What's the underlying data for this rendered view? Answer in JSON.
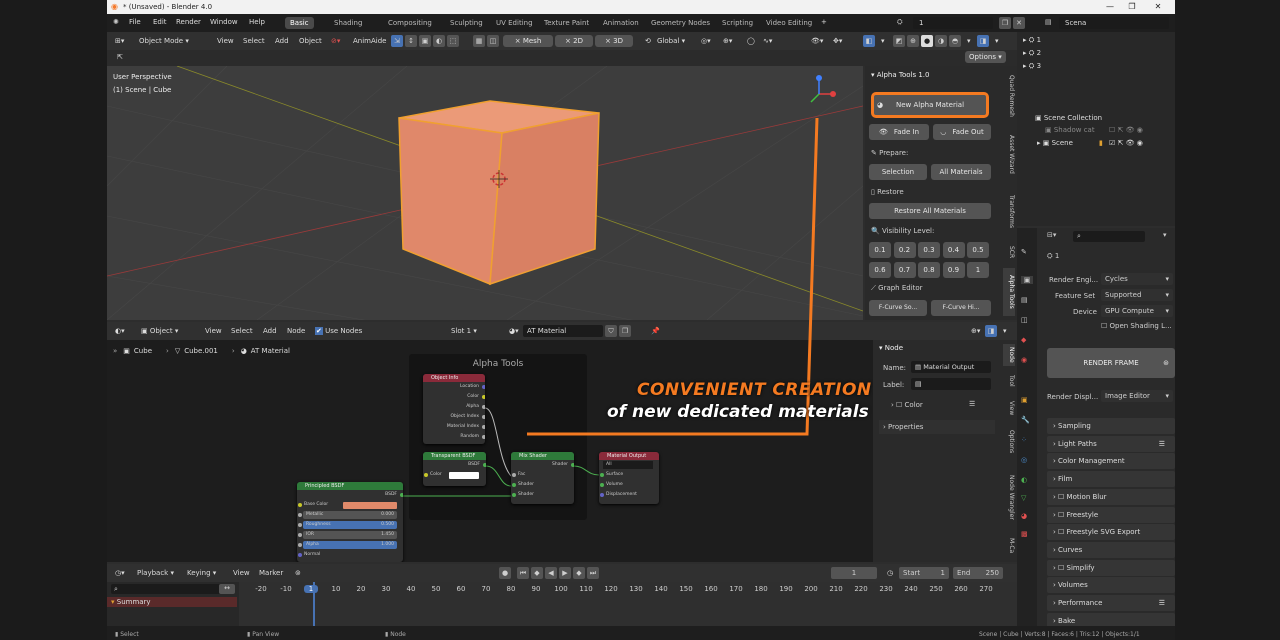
{
  "window": {
    "title": "* (Unsaved) - Blender 4.0",
    "min": "—",
    "max": "❐",
    "close": "✕"
  },
  "menu": [
    "File",
    "Edit",
    "Render",
    "Window",
    "Help"
  ],
  "workspaces": [
    "Basic",
    "Shading",
    "Compositing",
    "Sculpting",
    "UV Editing",
    "Texture Paint",
    "Animation",
    "Geometry Nodes",
    "Scripting",
    "Video Editing"
  ],
  "add_workspace": "+",
  "topright": {
    "scene_num": "1",
    "scene_name": "Scena"
  },
  "viewport_header": {
    "mode": "Object Mode",
    "view": "View",
    "select": "Select",
    "add": "Add",
    "object": "Object",
    "animaide": "AnimAide",
    "mesh": "× Mesh",
    "two_d": "× 2D",
    "three_d": "× 3D",
    "orientation": "Global",
    "options": "Options"
  },
  "viewport": {
    "perspective": "User Perspective",
    "scene_obj": "(1) Scene | Cube"
  },
  "alpha_panel": {
    "title": "Alpha Tools 1.0",
    "new_material": "New Alpha Material",
    "fade_in": "Fade In",
    "fade_out": "Fade Out",
    "prepare": "Prepare:",
    "selection": "Selection",
    "all_materials": "All Materials",
    "restore": "Restore",
    "restore_all": "Restore All Materials",
    "visibility": "Visibility Level:",
    "levels": [
      "0.1",
      "0.2",
      "0.3",
      "0.4",
      "0.5",
      "0.6",
      "0.7",
      "0.8",
      "0.9",
      "1"
    ],
    "graph_editor": "Graph Editor",
    "fcurve_so": "F-Curve So...",
    "fcurve_hi": "F-Curve Hi..."
  },
  "viewport_tabs": [
    "Quad Remesh",
    "Asset Wizard",
    "Transforms",
    "SCR",
    "Alpha Tools"
  ],
  "node_header": {
    "object": "Object",
    "view": "View",
    "select": "Select",
    "add": "Add",
    "node": "Node",
    "use_nodes": "Use Nodes",
    "slot": "Slot 1",
    "material": "AT Material"
  },
  "breadcrumb": {
    "obj": "Cube",
    "mesh": "Cube.001",
    "mat": "AT Material"
  },
  "frame": {
    "title": "Alpha Tools"
  },
  "nodes": {
    "object_info": {
      "title": "Object Info",
      "rows": [
        "Location",
        "Color",
        "Alpha",
        "Object Index",
        "Material Index",
        "Random"
      ]
    },
    "transparent": {
      "title": "Transparent BSDF",
      "out": "BSDF",
      "color": "Color"
    },
    "mix": {
      "title": "Mix Shader",
      "out": "Shader",
      "rows": [
        "Fac",
        "Shader",
        "Shader"
      ]
    },
    "output": {
      "title": "Material Output",
      "target": "All",
      "rows": [
        "Surface",
        "Volume",
        "Displacement"
      ]
    },
    "principled": {
      "title": "Principled BSDF",
      "out": "BSDF",
      "rows": [
        "Base Color",
        "Metallic",
        "Roughness",
        "IOR",
        "Alpha",
        "Normal"
      ],
      "values": [
        "",
        "0.000",
        "0.500",
        "1.450",
        "1.000",
        ""
      ]
    }
  },
  "callout": {
    "line1": "CONVENIENT CREATION",
    "line2": "of new dedicated materials"
  },
  "node_panel": {
    "node": "Node",
    "name_label": "Name:",
    "name_val": "Material Output",
    "label_label": "Label:",
    "color": "Color",
    "properties": "Properties"
  },
  "node_tabs": [
    "Node",
    "Tool",
    "View",
    "Options",
    "Node Wrangler",
    "M-Ca"
  ],
  "timeline": {
    "playback": "Playback",
    "keying": "Keying",
    "view": "View",
    "marker": "Marker",
    "frame": "1",
    "start_label": "Start",
    "start": "1",
    "end_label": "End",
    "end": "250",
    "summary": "Summary",
    "ticks": [
      "-20",
      "-10",
      "1",
      "10",
      "20",
      "30",
      "40",
      "50",
      "60",
      "70",
      "80",
      "90",
      "100",
      "110",
      "120",
      "130",
      "140",
      "150",
      "160",
      "170",
      "180",
      "190",
      "200",
      "210",
      "220",
      "230",
      "240",
      "250",
      "260",
      "270"
    ]
  },
  "outliner": {
    "rows": [
      "1",
      "2",
      "3"
    ],
    "collection": "Scene Collection",
    "shadow": "Shadow cat",
    "scene": "Scene"
  },
  "properties": {
    "engine_label": "Render Engi...",
    "engine": "Cycles",
    "feature_label": "Feature Set",
    "feature": "Supported",
    "device_label": "Device",
    "device": "GPU Compute",
    "osl": "Open Shading L...",
    "render_frame": "RENDER FRAME",
    "display_label": "Render Displ...",
    "display": "Image Editor",
    "scene_num": "1",
    "sections": [
      "Sampling",
      "Light Paths",
      "Color Management",
      "Film",
      "Motion Blur",
      "Freestyle",
      "Freestyle SVG Export",
      "Curves",
      "Simplify",
      "Volumes",
      "Performance",
      "Bake"
    ]
  },
  "status": {
    "select": "Select",
    "pan": "Pan View",
    "node": "Node",
    "info": "Scene | Cube | Verts:8 | Faces:6 | Tris:12 | Objects:1/1"
  },
  "colors": {
    "accent": "#f47a21",
    "select_blue": "#4772b3",
    "cube": "#e08a6a"
  }
}
